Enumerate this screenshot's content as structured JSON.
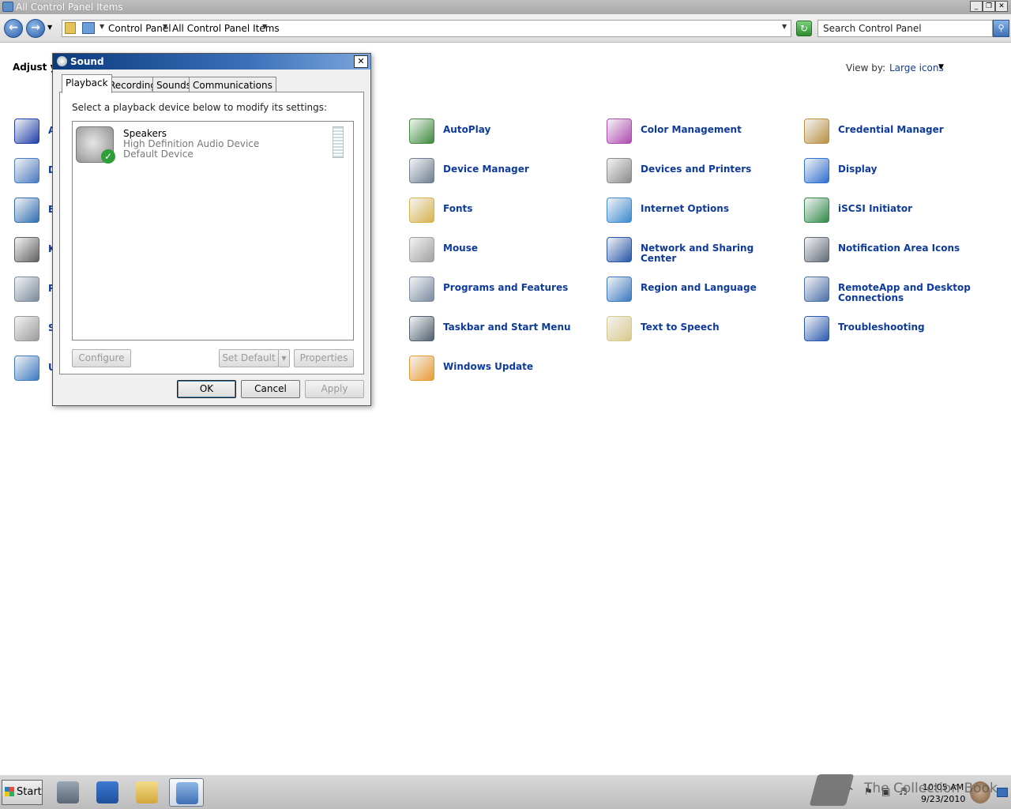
{
  "window": {
    "title": "All Control Panel Items",
    "min": "_",
    "max": "❐",
    "close": "✕"
  },
  "address": {
    "crumbs": [
      "Control Panel",
      "All Control Panel Items"
    ],
    "search_placeholder": "Search Control Panel"
  },
  "content": {
    "heading": "Adjust yo",
    "view_by_label": "View by:",
    "view_by_value": "Large icons",
    "hidden_column_letters": [
      "A",
      "D",
      "E",
      "K",
      "P",
      "S",
      "U"
    ],
    "items": [
      {
        "label": "AutoPlay",
        "icon": "autoplay-icon",
        "color": "#3b8a3b"
      },
      {
        "label": "Color Management",
        "icon": "color-management-icon",
        "color": "#b04ab0"
      },
      {
        "label": "Credential Manager",
        "icon": "credential-manager-icon",
        "color": "#b89040"
      },
      {
        "label": "Device Manager",
        "icon": "device-manager-icon",
        "color": "#6e7e90"
      },
      {
        "label": "Devices and Printers",
        "icon": "printer-icon",
        "color": "#8a8a8a"
      },
      {
        "label": "Display",
        "icon": "display-icon",
        "color": "#2f6fce"
      },
      {
        "label": "Fonts",
        "icon": "fonts-icon",
        "color": "#d8b24a"
      },
      {
        "label": "Internet Options",
        "icon": "internet-options-icon",
        "color": "#3a8ad0"
      },
      {
        "label": "iSCSI Initiator",
        "icon": "iscsi-icon",
        "color": "#2f8a4a"
      },
      {
        "label": "Mouse",
        "icon": "mouse-icon",
        "color": "#a0a0a0"
      },
      {
        "label": "Network and Sharing Center",
        "icon": "network-icon",
        "color": "#2656a8"
      },
      {
        "label": "Notification Area Icons",
        "icon": "notification-area-icon",
        "color": "#606a78"
      },
      {
        "label": "Programs and Features",
        "icon": "programs-icon",
        "color": "#7a8aa0"
      },
      {
        "label": "Region and Language",
        "icon": "region-icon",
        "color": "#3a7ac0"
      },
      {
        "label": "RemoteApp and Desktop Connections",
        "icon": "remoteapp-icon",
        "color": "#4a6ea8"
      },
      {
        "label": "Taskbar and Start Menu",
        "icon": "taskbar-icon",
        "color": "#506070"
      },
      {
        "label": "Text to Speech",
        "icon": "speech-icon",
        "color": "#d8c88a"
      },
      {
        "label": "Troubleshooting",
        "icon": "troubleshooting-icon",
        "color": "#2a5ab0"
      },
      {
        "label": "Windows Update",
        "icon": "windows-update-icon",
        "color": "#e89a30"
      }
    ]
  },
  "dialog": {
    "title": "Sound",
    "close": "✕",
    "tabs": [
      "Playback",
      "Recording",
      "Sounds",
      "Communications"
    ],
    "instruction": "Select a playback device below to modify its settings:",
    "device": {
      "name": "Speakers",
      "description": "High Definition Audio Device",
      "status": "Default Device"
    },
    "buttons": {
      "configure": "Configure",
      "set_default": "Set Default",
      "properties": "Properties",
      "ok": "OK",
      "cancel": "Cancel",
      "apply": "Apply"
    }
  },
  "taskbar": {
    "start": "Start",
    "time": "10:05 AM",
    "date": "9/23/2010",
    "watermark": "The Collection Book"
  }
}
